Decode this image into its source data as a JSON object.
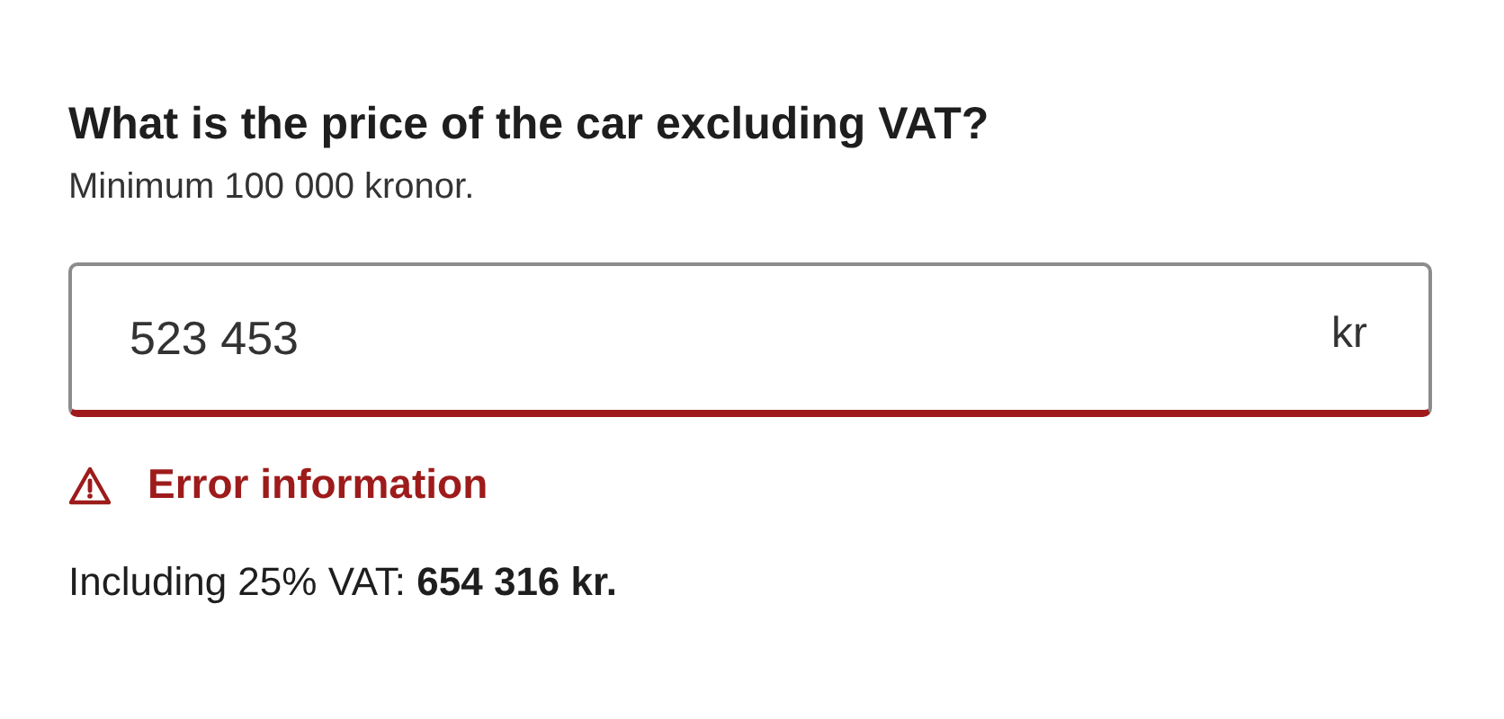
{
  "question": {
    "title": "What is the price of the car excluding VAT?",
    "hint": "Minimum 100 000 kronor."
  },
  "price_field": {
    "value": "523 453",
    "unit": "kr",
    "invalid": true
  },
  "error": {
    "message": "Error information"
  },
  "result": {
    "text": "Including 25% VAT: **654 316 kr.**"
  }
}
